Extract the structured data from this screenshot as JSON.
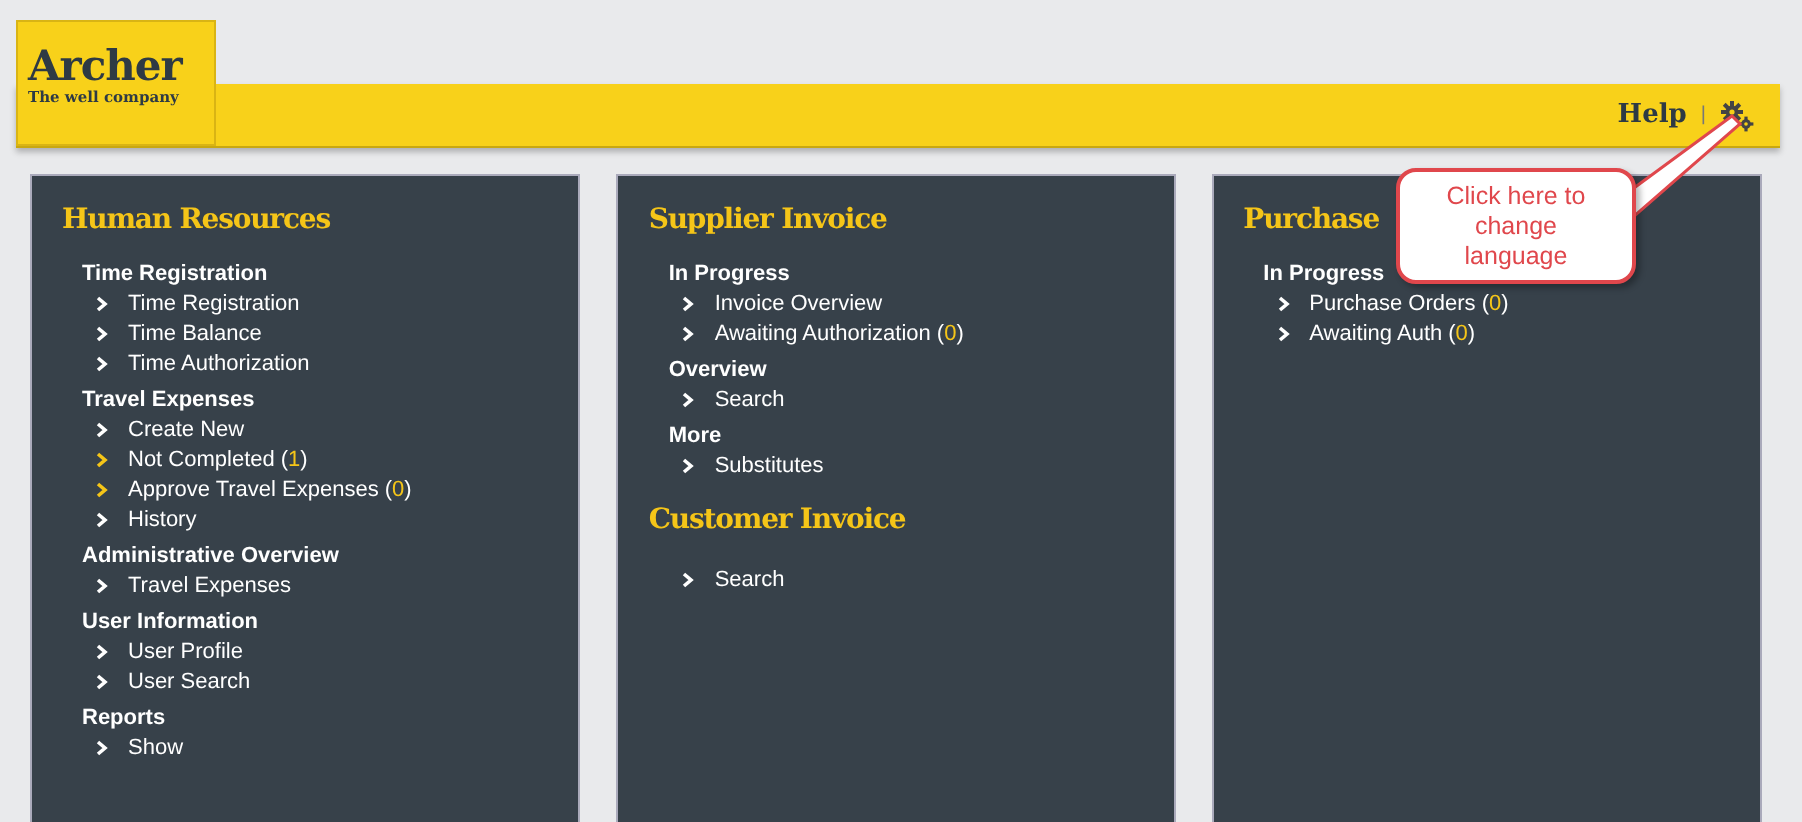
{
  "logo": {
    "name": "Archer",
    "tagline": "The well company"
  },
  "header": {
    "help": "Help",
    "separator": "|"
  },
  "callout": {
    "text": "Click here to change language"
  },
  "panels": [
    {
      "sections": [
        {
          "title": "Human Resources",
          "groups": [
            {
              "heading": "Time Registration",
              "items": [
                {
                  "label": "Time Registration",
                  "highlighted": false
                },
                {
                  "label": "Time Balance",
                  "highlighted": false
                },
                {
                  "label": "Time Authorization",
                  "highlighted": false
                }
              ]
            },
            {
              "heading": "Travel Expenses",
              "items": [
                {
                  "label": "Create New",
                  "highlighted": false
                },
                {
                  "label": "Not Completed",
                  "open": "(",
                  "count": "1",
                  "close": ")",
                  "highlighted": true
                },
                {
                  "label": "Approve Travel Expenses",
                  "open": "(",
                  "count": "0",
                  "close": ")",
                  "highlighted": true
                },
                {
                  "label": "History",
                  "highlighted": false
                }
              ]
            },
            {
              "heading": "Administrative Overview",
              "items": [
                {
                  "label": "Travel Expenses",
                  "highlighted": false
                }
              ]
            },
            {
              "heading": "User Information",
              "items": [
                {
                  "label": "User Profile",
                  "highlighted": false
                },
                {
                  "label": "User Search",
                  "highlighted": false
                }
              ]
            },
            {
              "heading": "Reports",
              "items": [
                {
                  "label": "Show",
                  "highlighted": false
                }
              ]
            }
          ]
        }
      ]
    },
    {
      "sections": [
        {
          "title": "Supplier Invoice",
          "groups": [
            {
              "heading": "In Progress",
              "items": [
                {
                  "label": "Invoice Overview",
                  "highlighted": false
                },
                {
                  "label": "Awaiting Authorization",
                  "open": "(",
                  "count": "0",
                  "close": ")",
                  "highlighted": false
                }
              ]
            },
            {
              "heading": "Overview",
              "items": [
                {
                  "label": "Search",
                  "highlighted": false
                }
              ]
            },
            {
              "heading": "More",
              "items": [
                {
                  "label": "Substitutes",
                  "highlighted": false
                }
              ]
            }
          ]
        },
        {
          "title": "Customer Invoice",
          "groups": [
            {
              "items": [
                {
                  "label": "Search",
                  "highlighted": false
                }
              ]
            }
          ]
        }
      ]
    },
    {
      "sections": [
        {
          "title": "Purchase",
          "groups": [
            {
              "heading": "In Progress",
              "items": [
                {
                  "label": "Purchase Orders",
                  "open": "(",
                  "count": "0",
                  "close": ")",
                  "highlighted": false
                },
                {
                  "label": "Awaiting Auth",
                  "open": "(",
                  "count": "0",
                  "close": ")",
                  "highlighted": false
                }
              ]
            }
          ]
        }
      ]
    }
  ]
}
